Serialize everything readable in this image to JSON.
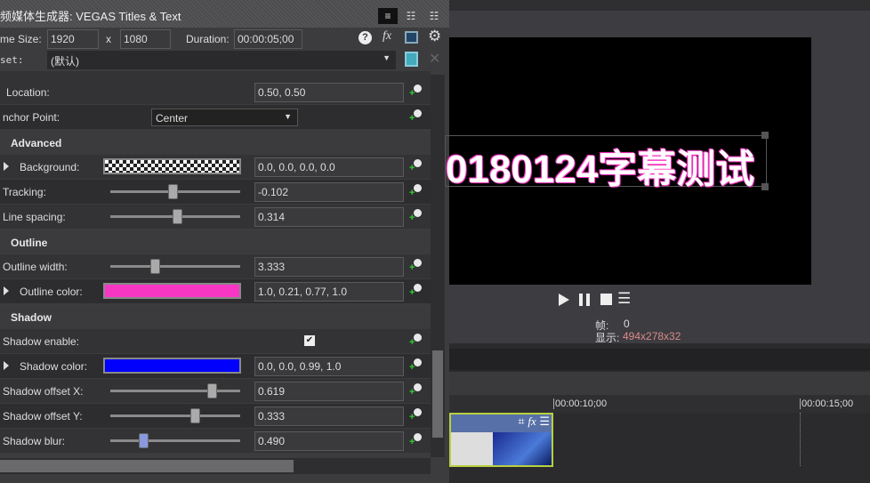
{
  "window": {
    "title": "频媒体生成器: VEGAS Titles & Text",
    "frame_size_label": "me Size:",
    "width": "1920",
    "x_label": "x",
    "height": "1080",
    "duration_label": "Duration:",
    "duration": "00:00:05;00",
    "preset_label": "set:",
    "preset": "(默认)"
  },
  "props": {
    "location": {
      "label": "Location:",
      "value": "0.50, 0.50"
    },
    "anchor": {
      "label": "nchor Point:",
      "value": "Center"
    },
    "advanced": "Advanced",
    "background": {
      "label": "Background:",
      "value": "0.0, 0.0, 0.0, 0.0"
    },
    "tracking": {
      "label": "Tracking:",
      "value": "-0.102",
      "slider": 0.48
    },
    "line_spacing": {
      "label": "Line spacing:",
      "value": "0.314",
      "slider": 0.52
    },
    "outline": "Outline",
    "outline_width": {
      "label": "Outline width:",
      "value": "3.333",
      "slider": 0.33
    },
    "outline_color": {
      "label": "Outline color:",
      "value": "1.0, 0.21, 0.77, 1.0",
      "color": "#f736c4"
    },
    "shadow": "Shadow",
    "shadow_enable": {
      "label": "Shadow enable:",
      "checked": true,
      "mark": "✔"
    },
    "shadow_color": {
      "label": "Shadow color:",
      "value": "0.0, 0.0, 0.99, 1.0",
      "color": "#0000fc"
    },
    "shadow_x": {
      "label": "Shadow offset X:",
      "value": "0.619",
      "slider": 0.81
    },
    "shadow_y": {
      "label": "Shadow offset Y:",
      "value": "0.333",
      "slider": 0.67
    },
    "shadow_blur": {
      "label": "Shadow blur:",
      "value": "0.490",
      "slider": 0.24
    }
  },
  "preview": {
    "text": "0180124字幕测试",
    "frame_label": "帧:",
    "frame": "0",
    "display_label": "显示:",
    "display": "494x278x32"
  },
  "timeline": {
    "t1": "00:00:10;00",
    "t2": "00:00:15;00"
  }
}
